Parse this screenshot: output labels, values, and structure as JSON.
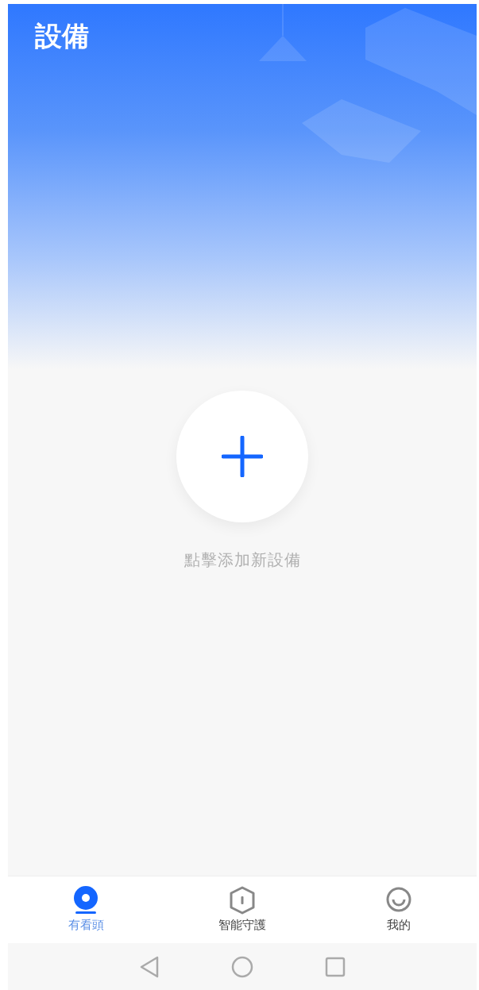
{
  "header": {
    "title": "設備"
  },
  "add_device": {
    "label": "點擊添加新設備"
  },
  "tabs": [
    {
      "kind": "camera",
      "label": "有看頭",
      "selected": true
    },
    {
      "kind": "shield",
      "label": "智能守護",
      "selected": false
    },
    {
      "kind": "profile",
      "label": "我的",
      "selected": false
    }
  ]
}
